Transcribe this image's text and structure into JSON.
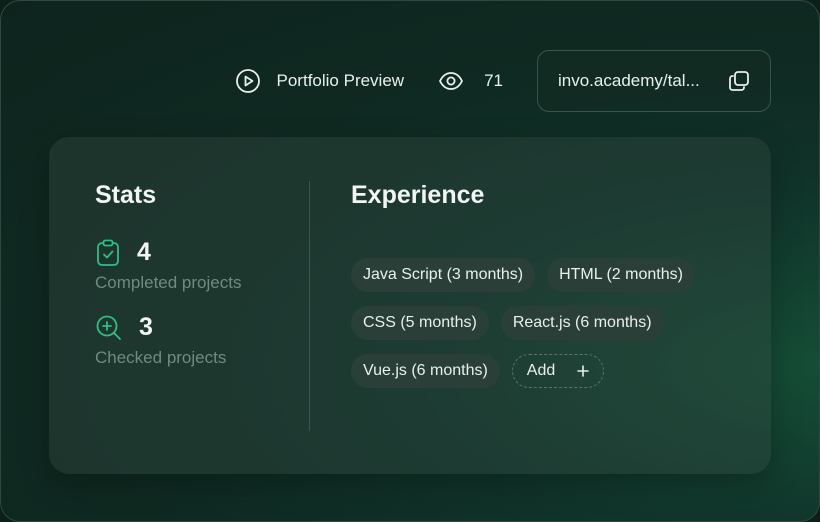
{
  "header": {
    "preview_label": "Portfolio Preview",
    "views_count": "71",
    "url": "invo.academy/tal..."
  },
  "stats": {
    "title": "Stats",
    "completed": {
      "value": "4",
      "label": "Completed projects"
    },
    "checked": {
      "value": "3",
      "label": "Checked projects"
    }
  },
  "experience": {
    "title": "Experience",
    "tags": [
      "Java Script (3 months)",
      "HTML (2 months)",
      "CSS (5 months)",
      "React.js (6 months)",
      "Vue.js (6 months)"
    ],
    "add_label": "Add"
  },
  "colors": {
    "accent": "#2fbf85",
    "text": "#e9efec",
    "muted": "#6f8a80"
  }
}
